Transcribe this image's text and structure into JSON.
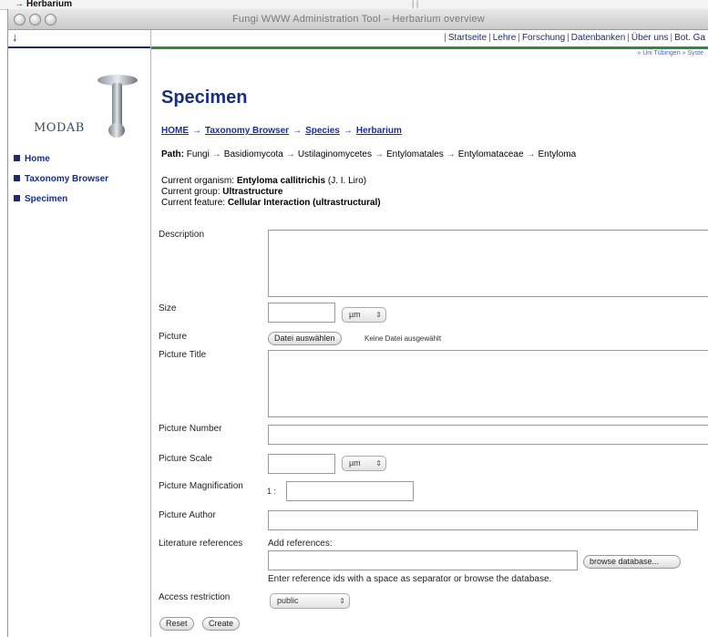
{
  "background": {
    "breadcrumb_prefix": "→",
    "breadcrumb_label": "Herbarium",
    "mini_label": "| |"
  },
  "window": {
    "title": "Fungi WWW Administration Tool – Herbarium overview"
  },
  "sidebar": {
    "download_icon": "↓",
    "logo_text": "MODAB",
    "items": [
      {
        "label": "Home"
      },
      {
        "label": "Taxonomy Browser"
      },
      {
        "label": "Specimen"
      }
    ]
  },
  "topnav": {
    "links": [
      "Startseite",
      "Lehre",
      "Forschung",
      "Datenbanken",
      "Über uns",
      "Bot. Ga"
    ],
    "sublinks": "» Uni Tübingen » Syste"
  },
  "page": {
    "title": "Specimen",
    "breadcrumb": [
      "HOME",
      "Taxonomy Browser",
      "Species",
      "Herbarium"
    ],
    "path_label": "Path:",
    "path": [
      "Fungi",
      "Basidiomycota",
      "Ustilaginomycetes",
      "Entylomatales",
      "Entylomataceae",
      "Entyloma"
    ],
    "organism_label": "Current organism:",
    "organism_name": "Entyloma callitrichis",
    "organism_author": "(J. I. Liro)",
    "group_label": "Current group:",
    "group_value": "Ultrastructure",
    "feature_label": "Current feature:",
    "feature_value": "Cellular Interaction (ultrastructural)"
  },
  "form": {
    "description_label": "Description",
    "description_value": "",
    "size_label": "Size",
    "size_value": "",
    "size_unit": "µm",
    "picture_label": "Picture",
    "file_button": "Datei auswählen",
    "file_status": "Keine Datei ausgewählt",
    "picture_title_label": "Picture Title",
    "picture_title_value": "",
    "picture_number_label": "Picture Number",
    "picture_number_value": "",
    "picture_scale_label": "Picture Scale",
    "picture_scale_value": "",
    "picture_scale_unit": "µm",
    "magnification_label": "Picture Magnification",
    "magnification_prefix": "1 :",
    "magnification_value": "",
    "author_label": "Picture Author",
    "author_value": "",
    "literature_label": "Literature references",
    "add_references_label": "Add references:",
    "references_value": "",
    "browse_button": "browse database...",
    "references_hint": "Enter reference ids with a space as separator or browse the database.",
    "access_label": "Access restriction",
    "access_value": "public",
    "reset_button": "Reset",
    "create_button": "Create"
  },
  "colors": {
    "nav_blue": "#1a2e7a",
    "green_rule": "#2e8b3e",
    "link_blue": "#1a2e9a"
  }
}
